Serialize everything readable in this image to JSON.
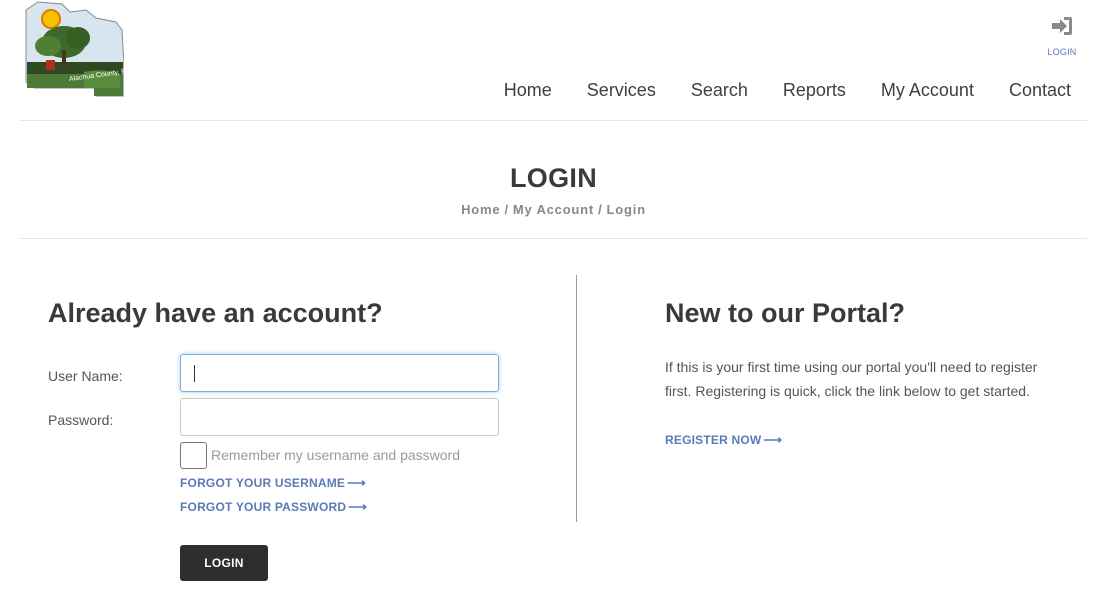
{
  "header": {
    "logo_text": "Alachua County, Florida",
    "login_label": "LOGIN",
    "nav": [
      "Home",
      "Services",
      "Search",
      "Reports",
      "My Account",
      "Contact"
    ]
  },
  "page": {
    "title": "LOGIN",
    "breadcrumb": [
      "Home",
      "My Account",
      "Login"
    ],
    "breadcrumb_sep": "/"
  },
  "login_form": {
    "heading": "Already have an account?",
    "username_label": "User Name:",
    "username_value": "",
    "password_label": "Password:",
    "password_value": "",
    "remember_label": "Remember my username and password",
    "forgot_username": "FORGOT YOUR USERNAME",
    "forgot_password": "FORGOT YOUR PASSWORD",
    "submit_label": "LOGIN"
  },
  "register": {
    "heading": "New to our Portal?",
    "intro": "If this is your first time using our portal you'll need to register first. Registering is quick, click the link below to get started.",
    "link_label": "REGISTER NOW"
  },
  "icons": {
    "login": "sign-in-icon",
    "arrow": "long-arrow-right-icon"
  },
  "colors": {
    "link": "#5b7ab8",
    "button": "#2e2e2e",
    "focus_border": "#7eaee0"
  }
}
